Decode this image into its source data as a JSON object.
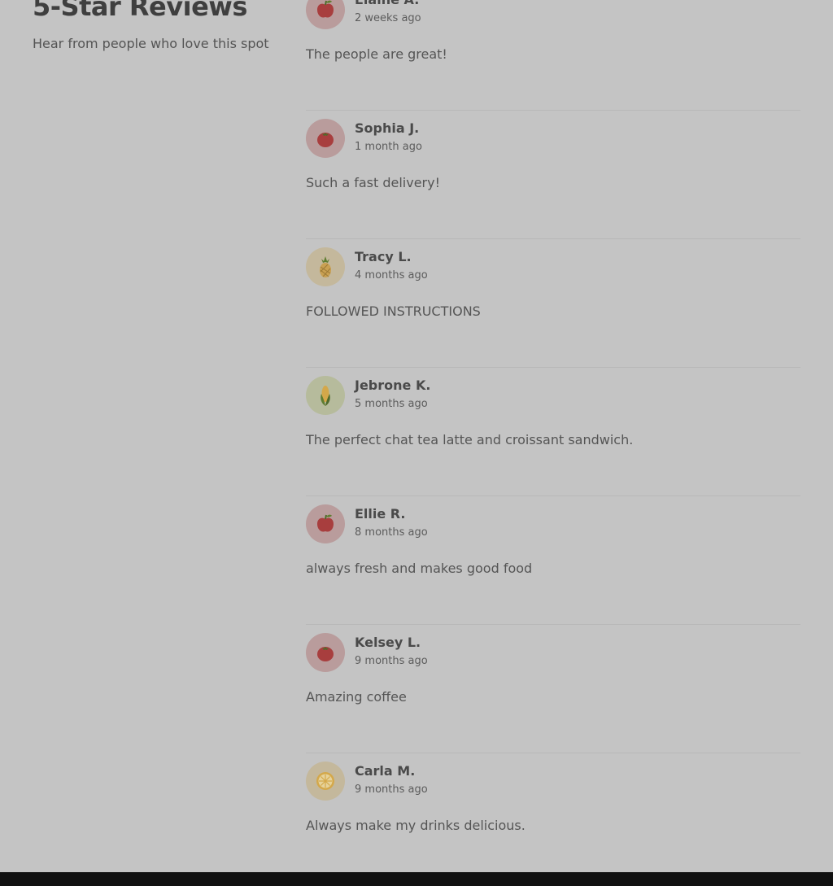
{
  "header": {
    "title": "5-Star Reviews",
    "subtitle": "Hear from people who love this spot"
  },
  "reviews": [
    {
      "name": "Elaine A.",
      "time": "2 weeks ago",
      "text": "The people are great!",
      "avatar_icon": "apple-icon",
      "avatar_bg": "#b99c9c"
    },
    {
      "name": "Sophia J.",
      "time": "1 month ago",
      "text": "Such a fast delivery!",
      "avatar_icon": "tomato-icon",
      "avatar_bg": "#b99c9c"
    },
    {
      "name": "Tracy L.",
      "time": "4 months ago",
      "text": "FOLLOWED INSTRUCTIONS",
      "avatar_icon": "pineapple-icon",
      "avatar_bg": "#c4b89c"
    },
    {
      "name": "Jebrone K.",
      "time": "5 months ago",
      "text": "The perfect chat tea latte and croissant sandwich.",
      "avatar_icon": "corn-icon",
      "avatar_bg": "#b6bb9c"
    },
    {
      "name": "Ellie R.",
      "time": "8 months ago",
      "text": "always fresh and makes good food",
      "avatar_icon": "apple-icon",
      "avatar_bg": "#b99c9c"
    },
    {
      "name": "Kelsey L.",
      "time": "9 months ago",
      "text": "Amazing coffee",
      "avatar_icon": "tomato-icon",
      "avatar_bg": "#b99c9c"
    },
    {
      "name": "Carla M.",
      "time": "9 months ago",
      "text": "Always make my drinks delicious.",
      "avatar_icon": "lemon-slice-icon",
      "avatar_bg": "#c4b89c"
    }
  ],
  "colors": {
    "background": "#c4c4c4",
    "divider": "#b8b8b8",
    "footer": "#111111"
  }
}
